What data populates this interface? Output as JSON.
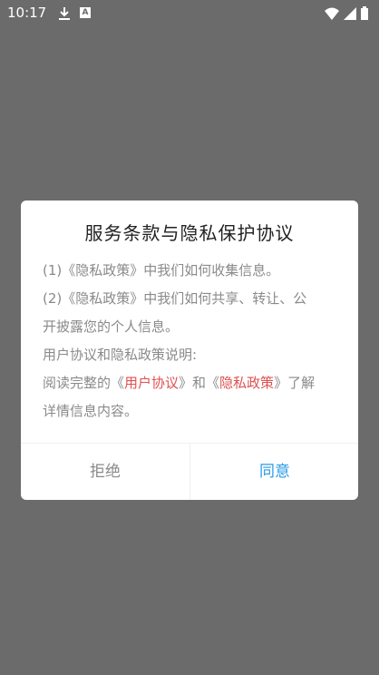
{
  "status_bar": {
    "time": "10:17"
  },
  "dialog": {
    "title": "服务条款与隐私保护协议",
    "line1": "(1)《隐私政策》中我们如何收集信息。",
    "line2a": "(2)《隐私政策》中我们如何共享、转让、公",
    "line2b": "开披露您的个人信息。",
    "line3": "用户协议和隐私政策说明:",
    "line4_prefix": "阅读完整的《",
    "link_user": "用户协议",
    "line4_mid": "》和《",
    "link_privacy": "隐私政策",
    "line4_suffix": "》了解",
    "line5": "详情信息内容。",
    "reject_label": "拒绝",
    "agree_label": "同意"
  },
  "colors": {
    "overlay": "#6b6b6b",
    "link": "#e05050",
    "accent": "#2a9be6"
  }
}
